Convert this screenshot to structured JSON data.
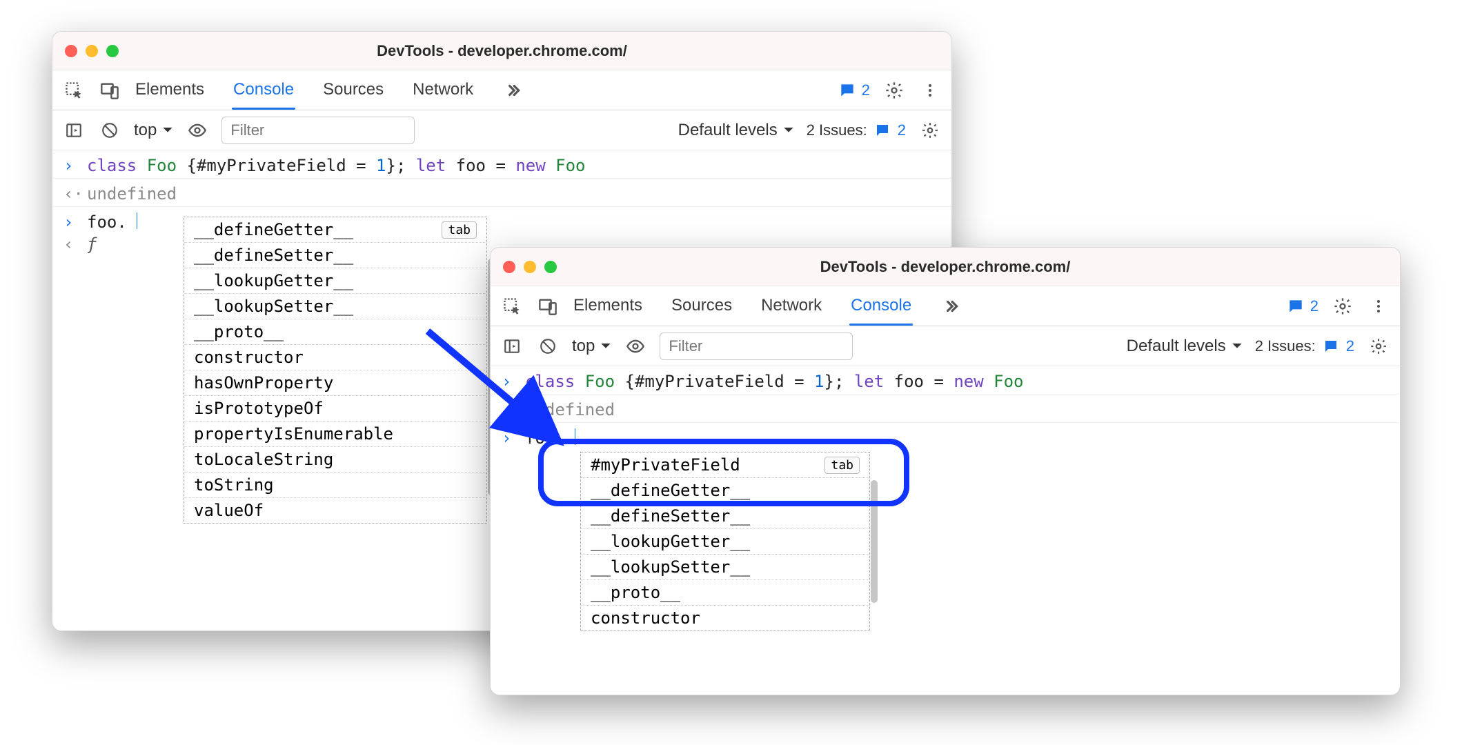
{
  "window1": {
    "title": "DevTools - developer.chrome.com/",
    "tabs": [
      "Elements",
      "Console",
      "Sources",
      "Network"
    ],
    "activeTab": "Console",
    "issuesBadge": "2",
    "toolbar": {
      "context": "top",
      "filterPlaceholder": "Filter",
      "levels": "Default levels",
      "issuesLabel": "2 Issues:",
      "issuesCount": "2"
    },
    "console": {
      "input1_raw": "class Foo {#myPrivateField = 1}; let foo = new Foo",
      "tokens1": [
        {
          "t": "class ",
          "c": "kw-class"
        },
        {
          "t": "Foo ",
          "c": "kw-name"
        },
        {
          "t": "{#myPrivateField = ",
          "c": ""
        },
        {
          "t": "1",
          "c": "kw-num"
        },
        {
          "t": "}; ",
          "c": ""
        },
        {
          "t": "let ",
          "c": "kw-let"
        },
        {
          "t": "foo = ",
          "c": ""
        },
        {
          "t": "new ",
          "c": "kw-new"
        },
        {
          "t": "Foo",
          "c": "kw-name"
        }
      ],
      "output1": "undefined",
      "input2": "foo.",
      "resultGlyph": "ƒ",
      "autocomplete": [
        "__defineGetter__",
        "__defineSetter__",
        "__lookupGetter__",
        "__lookupSetter__",
        "__proto__",
        "constructor",
        "hasOwnProperty",
        "isPrototypeOf",
        "propertyIsEnumerable",
        "toLocaleString",
        "toString",
        "valueOf"
      ],
      "tabHint": "tab"
    }
  },
  "window2": {
    "title": "DevTools - developer.chrome.com/",
    "tabs": [
      "Elements",
      "Sources",
      "Network",
      "Console"
    ],
    "activeTab": "Console",
    "issuesBadge": "2",
    "toolbar": {
      "context": "top",
      "filterPlaceholder": "Filter",
      "levels": "Default levels",
      "issuesLabel": "2 Issues:",
      "issuesCount": "2"
    },
    "console": {
      "tokens1": [
        {
          "t": "class ",
          "c": "kw-class"
        },
        {
          "t": "Foo ",
          "c": "kw-name"
        },
        {
          "t": "{#myPrivateField = ",
          "c": ""
        },
        {
          "t": "1",
          "c": "kw-num"
        },
        {
          "t": "}; ",
          "c": ""
        },
        {
          "t": "let ",
          "c": "kw-let"
        },
        {
          "t": "foo = ",
          "c": ""
        },
        {
          "t": "new ",
          "c": "kw-new"
        },
        {
          "t": "Foo",
          "c": "kw-name"
        }
      ],
      "output1": "undefined",
      "input2": "foo.",
      "autocomplete": [
        "#myPrivateField",
        "__defineGetter__",
        "__defineSetter__",
        "__lookupGetter__",
        "__lookupSetter__",
        "__proto__",
        "constructor"
      ],
      "tabHint": "tab"
    }
  }
}
